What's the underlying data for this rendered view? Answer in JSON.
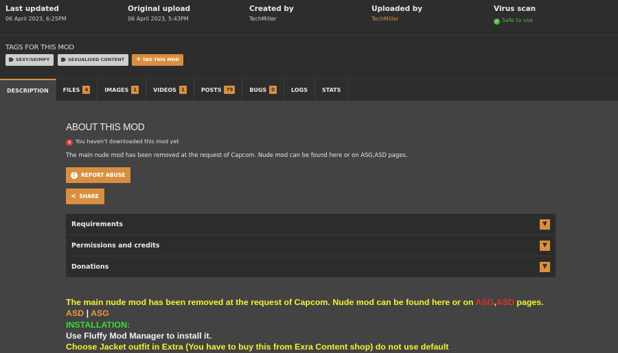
{
  "meta": [
    {
      "heading": "Last updated",
      "value": "06 April 2023,  6:25PM"
    },
    {
      "heading": "Original upload",
      "value": "06 April 2023,  5:43PM"
    },
    {
      "heading": "Created by",
      "value": "TechMiller"
    },
    {
      "heading": "Uploaded by",
      "value": "TechMiller"
    },
    {
      "heading": "Virus scan",
      "value": "Safe to use"
    }
  ],
  "tags": {
    "title": "TAGS FOR THIS MOD",
    "items": [
      "SEXY/SKIMPY",
      "SEXUALISED CONTENT"
    ],
    "add_label": "TAG THIS MOD"
  },
  "tabs": [
    {
      "label": "DESCRIPTION",
      "count": null
    },
    {
      "label": "FILES",
      "count": "4"
    },
    {
      "label": "IMAGES",
      "count": "1"
    },
    {
      "label": "VIDEOS",
      "count": "1"
    },
    {
      "label": "POSTS",
      "count": "79"
    },
    {
      "label": "BUGS",
      "count": "0"
    },
    {
      "label": "LOGS",
      "count": null
    },
    {
      "label": "STATS",
      "count": null
    }
  ],
  "about": {
    "title": "ABOUT THIS MOD",
    "not_downloaded": "You haven't downloaded this mod yet",
    "description": "The main nude mod has been removed at the request of Capcom. Nude mod can be found here or on ASG,ASD pages.",
    "report_label": "REPORT ABUSE",
    "share_label": "SHARE"
  },
  "accordion": [
    "Requirements",
    "Permissions and credits",
    "Donations"
  ],
  "body": {
    "line1_start": "The main nude mod has been removed at the request of Capcom. Nude mod can be found here or on ",
    "line1_asg": "ASG",
    "line1_comma": ",",
    "line1_asd": "ASD",
    "line1_end": " pages.",
    "link_asd": "ASD",
    "link_sep": " | ",
    "link_asg": "ASG",
    "installation": "INSTALLATION:",
    "step1": "Use Fluffy Mod Manager to install it.",
    "step2": "Choose Jacket outfit in Extra (You have to buy this from Exra Content shop) do not use default"
  },
  "colors": {
    "accent": "#d98f40",
    "safe": "#57b649",
    "warning_red": "#e03030",
    "installation_green": "#2fe12f",
    "body_yellow": "#f4f233"
  }
}
